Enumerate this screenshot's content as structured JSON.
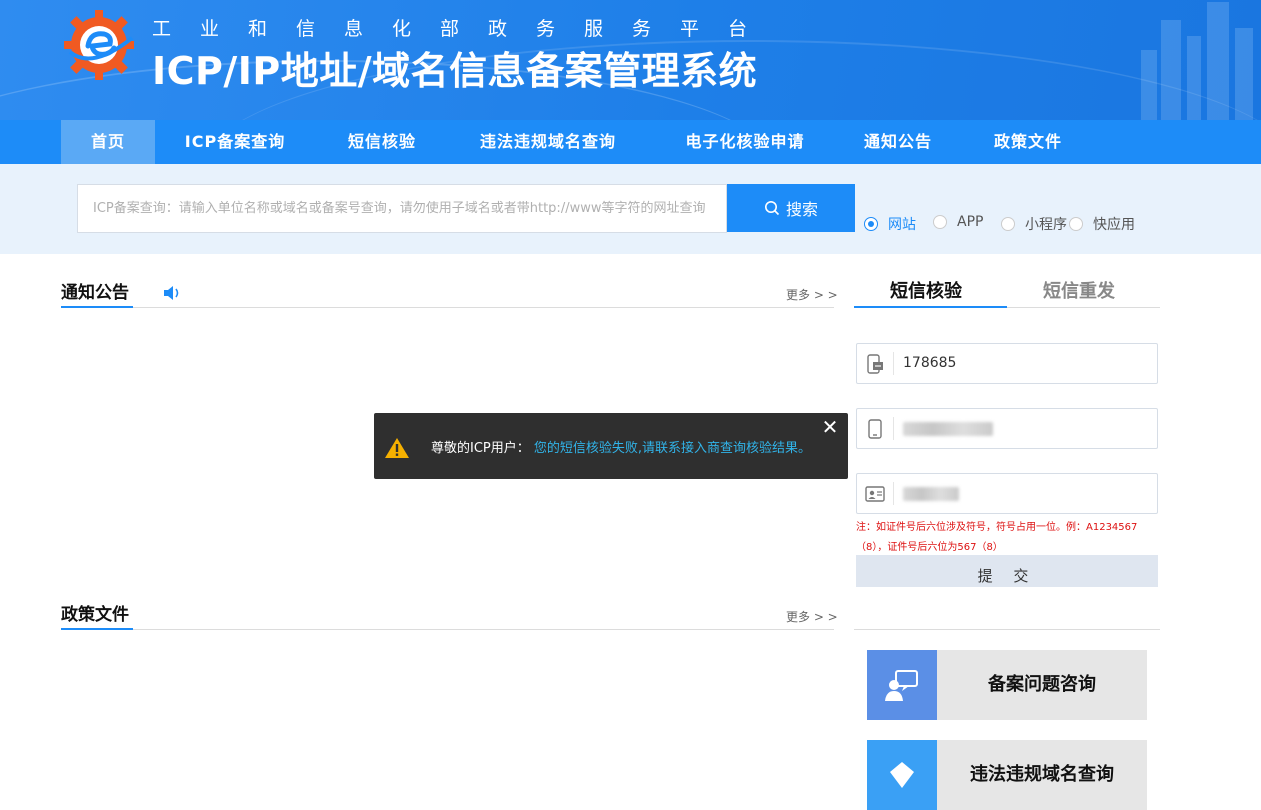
{
  "header": {
    "subtitle": "工业和信息化部政务服务平台",
    "title": "ICP/IP地址/域名信息备案管理系统"
  },
  "nav": {
    "items": [
      {
        "label": "首页",
        "active": true
      },
      {
        "label": "ICP备案查询"
      },
      {
        "label": "短信核验"
      },
      {
        "label": "违法违规域名查询"
      },
      {
        "label": "电子化核验申请"
      },
      {
        "label": "通知公告"
      },
      {
        "label": "政策文件"
      }
    ]
  },
  "search": {
    "placeholder": "ICP备案查询：请输入单位名称或域名或备案号查询，请勿使用子域名或者带http://www等字符的网址查询",
    "button_label": "搜索",
    "options": [
      {
        "label": "网站",
        "selected": true
      },
      {
        "label": "APP"
      },
      {
        "label": "小程序"
      },
      {
        "label": "快应用"
      }
    ]
  },
  "notice": {
    "title": "通知公告",
    "more": "更多 > >"
  },
  "policy": {
    "title": "政策文件",
    "more": "更多 > >"
  },
  "sms": {
    "tab_verify": "短信核验",
    "tab_resend": "短信重发",
    "code_value": "178685",
    "note": "注：如证件号后六位涉及符号，符号占用一位。例：A1234567（8），证件号后六位为567（8）",
    "submit_label": "提 交"
  },
  "quick_links": [
    {
      "label": "备案问题咨询",
      "icon": "consult-icon",
      "color": "#5b8fe6"
    },
    {
      "label": "违法违规域名查询",
      "icon": "shield-icon",
      "color": "#3aa0f5"
    }
  ],
  "toast": {
    "prefix": "尊敬的ICP用户：",
    "message": "您的短信核验失败,请联系接入商查询核验结果。"
  },
  "colors": {
    "primary": "#1d8cf8",
    "nav_active": "#5aa9f5",
    "note_red": "#dd1111",
    "toast_highlight": "#31b3e8"
  }
}
